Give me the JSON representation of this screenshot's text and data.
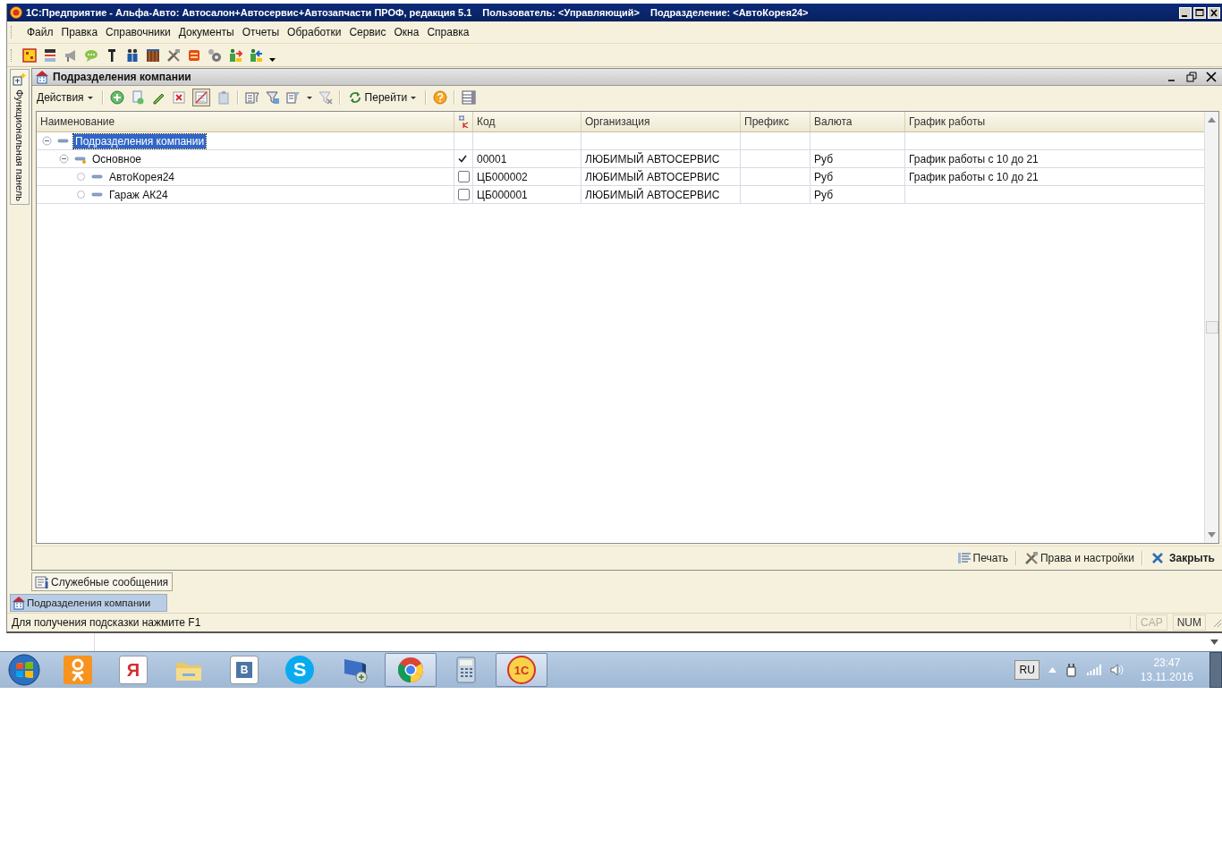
{
  "window": {
    "title": "1С:Предприятие - Альфа-Авто: Автосалон+Автосервис+Автозапчасти ПРОФ, редакция 5.1",
    "user": "Пользователь: <Управляющий>",
    "department": "Подразделение: <АвтоКорея24>"
  },
  "menu": [
    "Файл",
    "Правка",
    "Справочники",
    "Документы",
    "Отчеты",
    "Обработки",
    "Сервис",
    "Окна",
    "Справка"
  ],
  "side_panel": {
    "label": "Функциональная панель"
  },
  "form": {
    "title": "Подразделения компании",
    "toolbar": {
      "actions": "Действия",
      "goto": "Перейти",
      "marked_toggle_on": true
    },
    "columns": [
      {
        "kind": "name",
        "label": "Наименование"
      },
      {
        "kind": "flag"
      },
      {
        "kind": "code",
        "label": "Код"
      },
      {
        "kind": "organization",
        "label": "Организация"
      },
      {
        "kind": "prefix",
        "label": "Префикс"
      },
      {
        "kind": "currency",
        "label": "Валюта"
      },
      {
        "kind": "schedule",
        "label": "График работы"
      }
    ],
    "rows": [
      {
        "name": "Подразделения компании",
        "expanded": true,
        "selected": true,
        "children": [
          {
            "name": "Основное",
            "expanded": true,
            "selected": false,
            "checked": true,
            "code": "00001",
            "organization": "ЛЮБИМЫЙ АВТОСЕРВИС",
            "currency": "Руб",
            "schedule": "График работы с 10 до 21",
            "children": [
              {
                "name": "АвтоКорея24",
                "selected": false,
                "checked": false,
                "code": "ЦБ000002",
                "organization": "ЛЮБИМЫЙ АВТОСЕРВИС",
                "currency": "Руб",
                "schedule": "График работы с 10 до 21"
              },
              {
                "name": "Гараж АК24",
                "selected": false,
                "checked": false,
                "code": "ЦБ000001",
                "organization": "ЛЮБИМЫЙ АВТОСЕРВИС",
                "currency": "Руб"
              }
            ]
          }
        ]
      }
    ],
    "footer_buttons": [
      {
        "kind": "print",
        "label": "Печать"
      },
      {
        "kind": "settings",
        "label": "Права и настройки"
      },
      {
        "kind": "close",
        "label": "Закрыть"
      }
    ]
  },
  "messages_button": "Служебные сообщения",
  "window_tabs": [
    {
      "label": "Подразделения компании",
      "selected": true
    }
  ],
  "status_bar": {
    "hint": "Для получения подсказки нажмите F1",
    "indicators": [
      {
        "label": "CAP",
        "on": false
      },
      {
        "label": "NUM",
        "on": true
      }
    ]
  },
  "taskbar": {
    "apps": [
      {
        "kind": "ok",
        "active": false
      },
      {
        "kind": "yandex",
        "glyph": "Я",
        "active": false
      },
      {
        "kind": "folder",
        "active": false
      },
      {
        "kind": "vk",
        "glyph": "В",
        "active": false
      },
      {
        "kind": "skype",
        "glyph": "S",
        "active": false
      },
      {
        "kind": "network",
        "active": false
      },
      {
        "kind": "chrome",
        "active": true
      },
      {
        "kind": "calculator",
        "active": false
      },
      {
        "kind": "onec",
        "glyph": "1С",
        "active": true
      }
    ],
    "language": "RU",
    "time": "23:47",
    "date": "13.11.2016"
  }
}
